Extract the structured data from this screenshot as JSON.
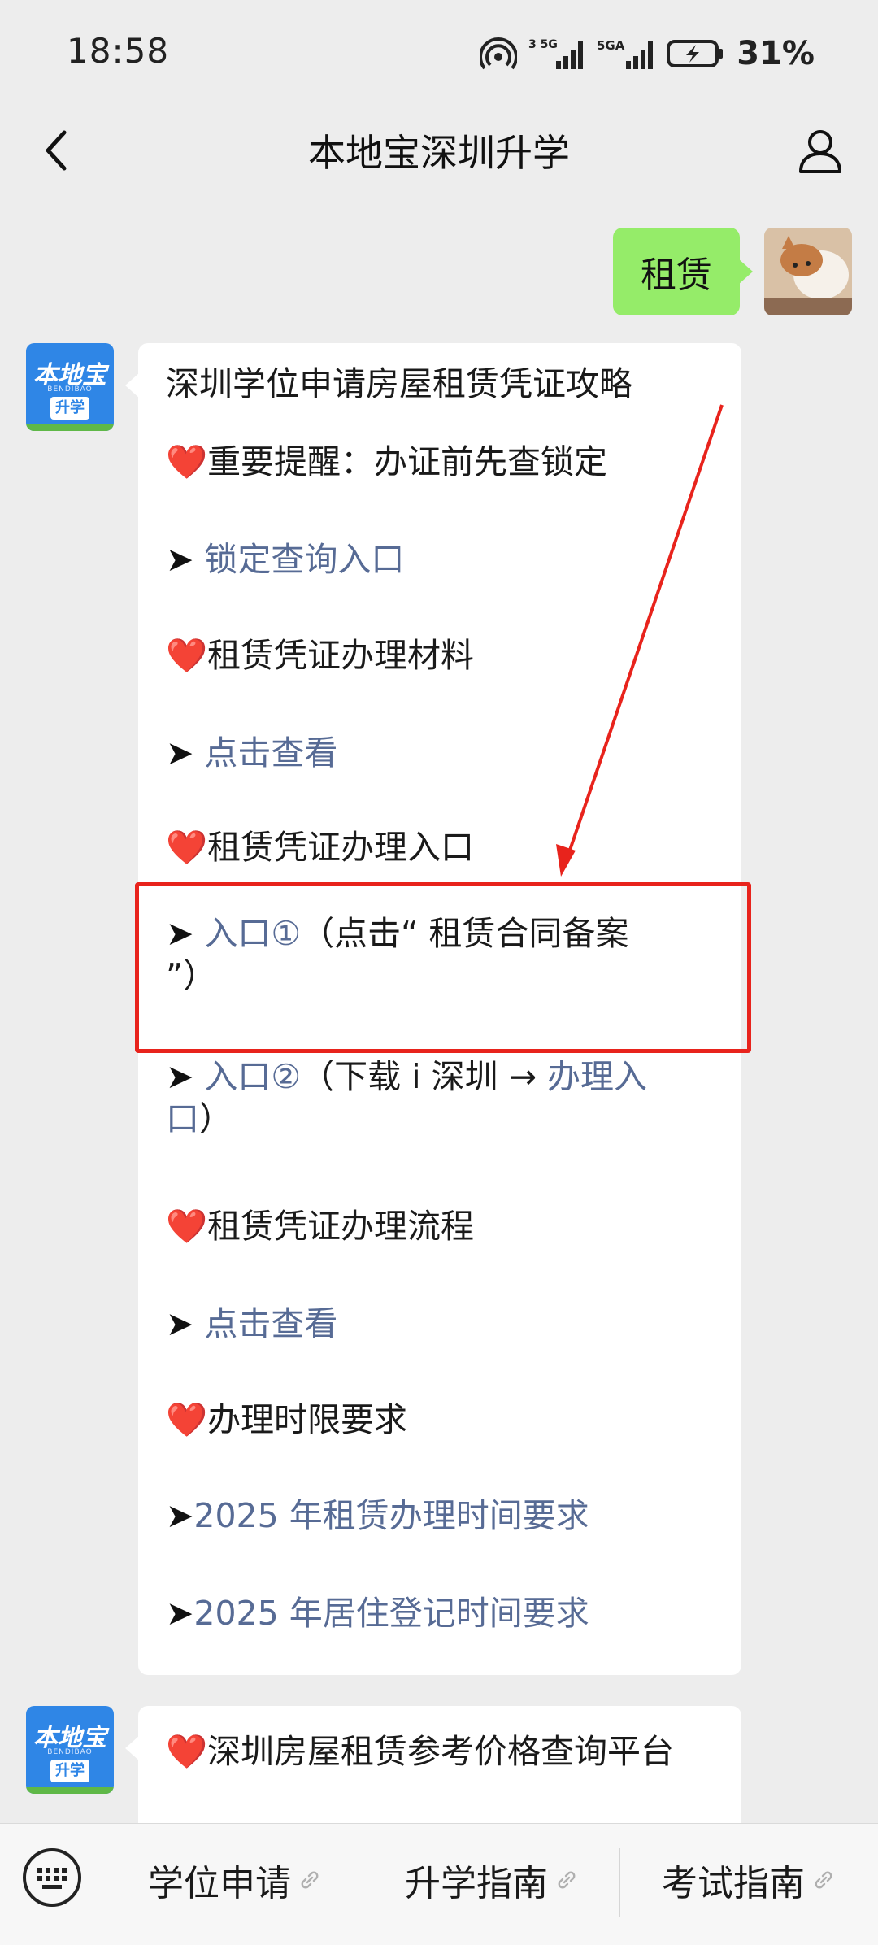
{
  "status": {
    "time": "18:58",
    "battery": "31%",
    "net1": "3 5G",
    "net2": "5GA"
  },
  "nav": {
    "title": "本地宝深圳升学"
  },
  "outgoing": {
    "text": "租赁"
  },
  "bot_avatar": {
    "brand_top": "本地宝",
    "brand_sub": "BENDIBAO",
    "badge": "升学"
  },
  "message1": {
    "title": "深圳学位申请房屋租赁凭证攻略",
    "lines": [
      {
        "icon": "❤️",
        "text": "重要提醒：办证前先查锁定"
      },
      {
        "icon": "➤",
        "link": "锁定查询入口"
      },
      {
        "icon": "❤️",
        "text": "租赁凭证办理材料"
      },
      {
        "icon": "➤",
        "link": "点击查看"
      },
      {
        "icon": "❤️",
        "text": "租赁凭证办理入口"
      },
      {
        "icon": "➤",
        "link": "入口①",
        "text": "（点击“ 租赁合同备案",
        "text2": "”）"
      },
      {
        "icon": "➤",
        "link": "入口②",
        "text": "（下载 i 深圳 →",
        "link2": "办理入",
        "link3": "口",
        "text3": "）"
      },
      {
        "icon": "❤️",
        "text": "租赁凭证办理流程"
      },
      {
        "icon": "➤",
        "link": "点击查看"
      },
      {
        "icon": "❤️",
        "text": "办理时限要求"
      },
      {
        "icon": "➤",
        "link": "2025 年租赁办理时间要求"
      },
      {
        "icon": "➤",
        "link": "2025 年居住登记时间要求"
      }
    ]
  },
  "message2": {
    "icon": "❤️",
    "text": "深圳房屋租赁参考价格查询平台"
  },
  "menu": {
    "items": [
      "学位申请",
      "升学指南",
      "考试指南"
    ]
  },
  "colors": {
    "link": "#576b95",
    "outgoing_bubble": "#95ec69",
    "annotation": "#e8231c",
    "background": "#ededed"
  }
}
